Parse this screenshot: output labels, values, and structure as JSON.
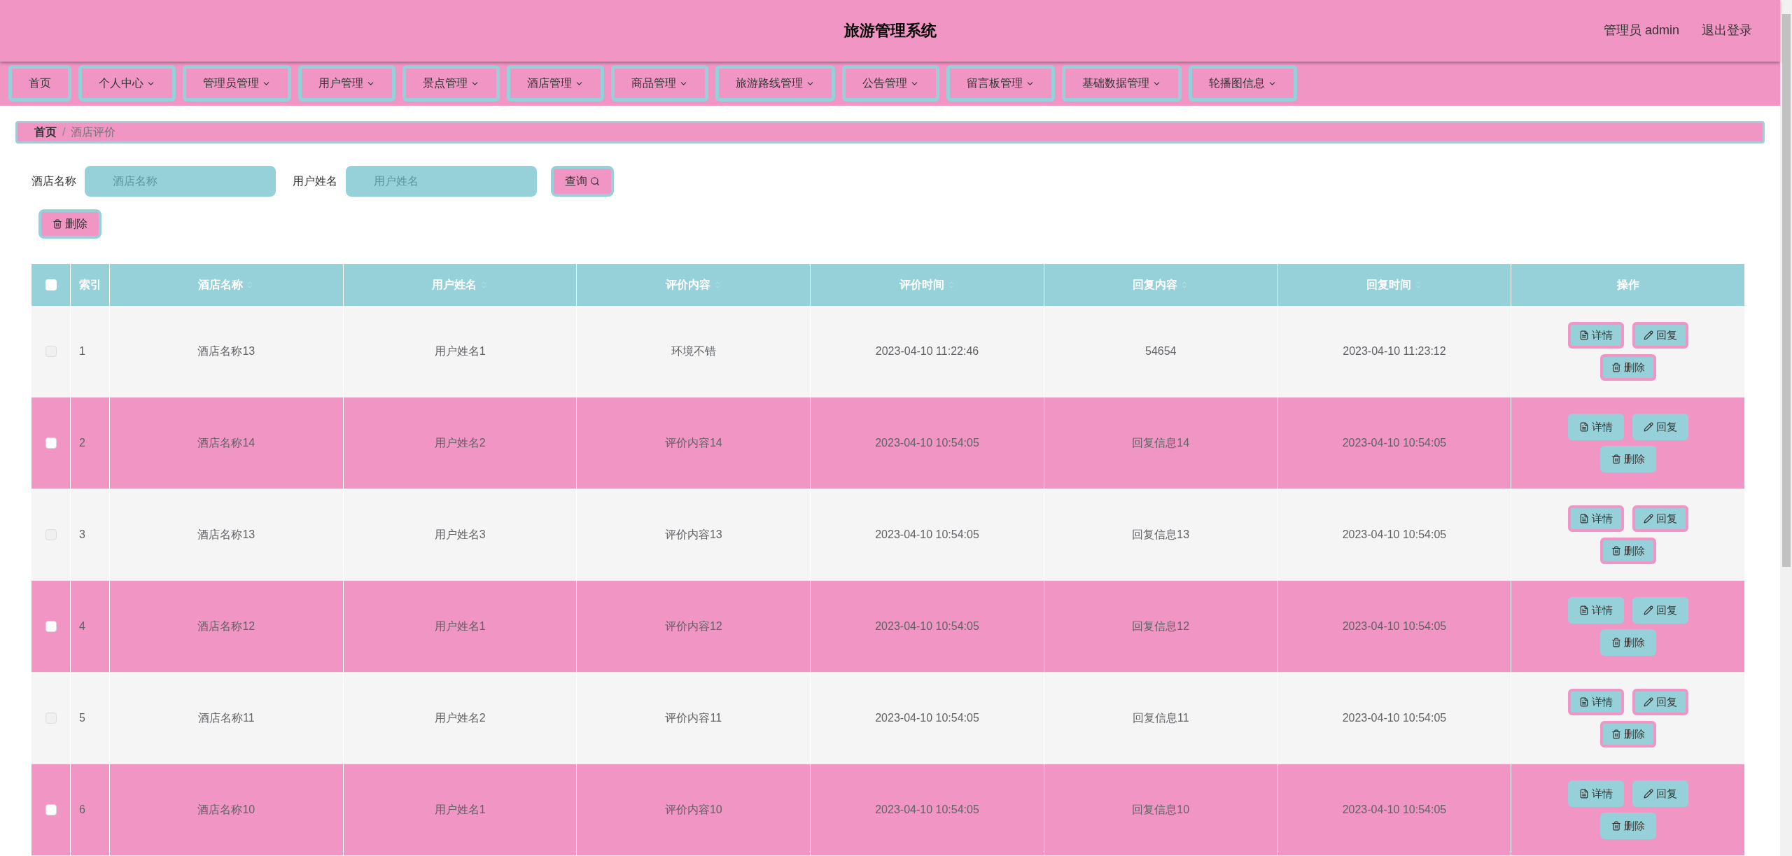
{
  "header": {
    "title": "旅游管理系统",
    "user": "管理员 admin",
    "logout": "退出登录"
  },
  "nav": [
    {
      "label": "首页",
      "dropdown": false
    },
    {
      "label": "个人中心",
      "dropdown": true
    },
    {
      "label": "管理员管理",
      "dropdown": true
    },
    {
      "label": "用户管理",
      "dropdown": true
    },
    {
      "label": "景点管理",
      "dropdown": true
    },
    {
      "label": "酒店管理",
      "dropdown": true
    },
    {
      "label": "商品管理",
      "dropdown": true
    },
    {
      "label": "旅游路线管理",
      "dropdown": true
    },
    {
      "label": "公告管理",
      "dropdown": true
    },
    {
      "label": "留言板管理",
      "dropdown": true
    },
    {
      "label": "基础数据管理",
      "dropdown": true
    },
    {
      "label": "轮播图信息",
      "dropdown": true
    }
  ],
  "breadcrumb": {
    "items": [
      "首页",
      "酒店评价"
    ],
    "separator": "/"
  },
  "search": {
    "fields": [
      {
        "label": "酒店名称",
        "placeholder": "酒店名称"
      },
      {
        "label": "用户姓名",
        "placeholder": "用户姓名"
      }
    ],
    "button": "查询"
  },
  "toolbar": {
    "delete": "删除"
  },
  "table": {
    "select_all": {
      "checked": false
    },
    "columns": [
      {
        "label": "索引",
        "sortable": false
      },
      {
        "label": "酒店名称",
        "sortable": true
      },
      {
        "label": "用户姓名",
        "sortable": true
      },
      {
        "label": "评价内容",
        "sortable": true
      },
      {
        "label": "评价时间",
        "sortable": true
      },
      {
        "label": "回复内容",
        "sortable": true
      },
      {
        "label": "回复时间",
        "sortable": true
      },
      {
        "label": "操作",
        "sortable": false
      }
    ],
    "rows": [
      {
        "checked": false,
        "cells": [
          "1",
          "酒店名称13",
          "用户姓名1",
          "环境不错",
          "2023-04-10 11:22:46",
          "54654",
          "2023-04-10 11:23:12"
        ],
        "actions": [
          "详情",
          "回复",
          "删除"
        ]
      },
      {
        "checked": false,
        "cells": [
          "2",
          "酒店名称14",
          "用户姓名2",
          "评价内容14",
          "2023-04-10 10:54:05",
          "回复信息14",
          "2023-04-10 10:54:05"
        ],
        "actions": [
          "详情",
          "回复",
          "删除"
        ]
      },
      {
        "checked": false,
        "cells": [
          "3",
          "酒店名称13",
          "用户姓名3",
          "评价内容13",
          "2023-04-10 10:54:05",
          "回复信息13",
          "2023-04-10 10:54:05"
        ],
        "actions": [
          "详情",
          "回复",
          "删除"
        ]
      },
      {
        "checked": false,
        "cells": [
          "4",
          "酒店名称12",
          "用户姓名1",
          "评价内容12",
          "2023-04-10 10:54:05",
          "回复信息12",
          "2023-04-10 10:54:05"
        ],
        "actions": [
          "详情",
          "回复",
          "删除"
        ]
      },
      {
        "checked": false,
        "cells": [
          "5",
          "酒店名称11",
          "用户姓名2",
          "评价内容11",
          "2023-04-10 10:54:05",
          "回复信息11",
          "2023-04-10 10:54:05"
        ],
        "actions": [
          "详情",
          "回复",
          "删除"
        ]
      },
      {
        "checked": false,
        "cells": [
          "6",
          "酒店名称10",
          "用户姓名1",
          "评价内容10",
          "2023-04-10 10:54:05",
          "回复信息10",
          "2023-04-10 10:54:05"
        ],
        "actions": [
          "详情",
          "回复",
          "删除"
        ]
      }
    ]
  }
}
